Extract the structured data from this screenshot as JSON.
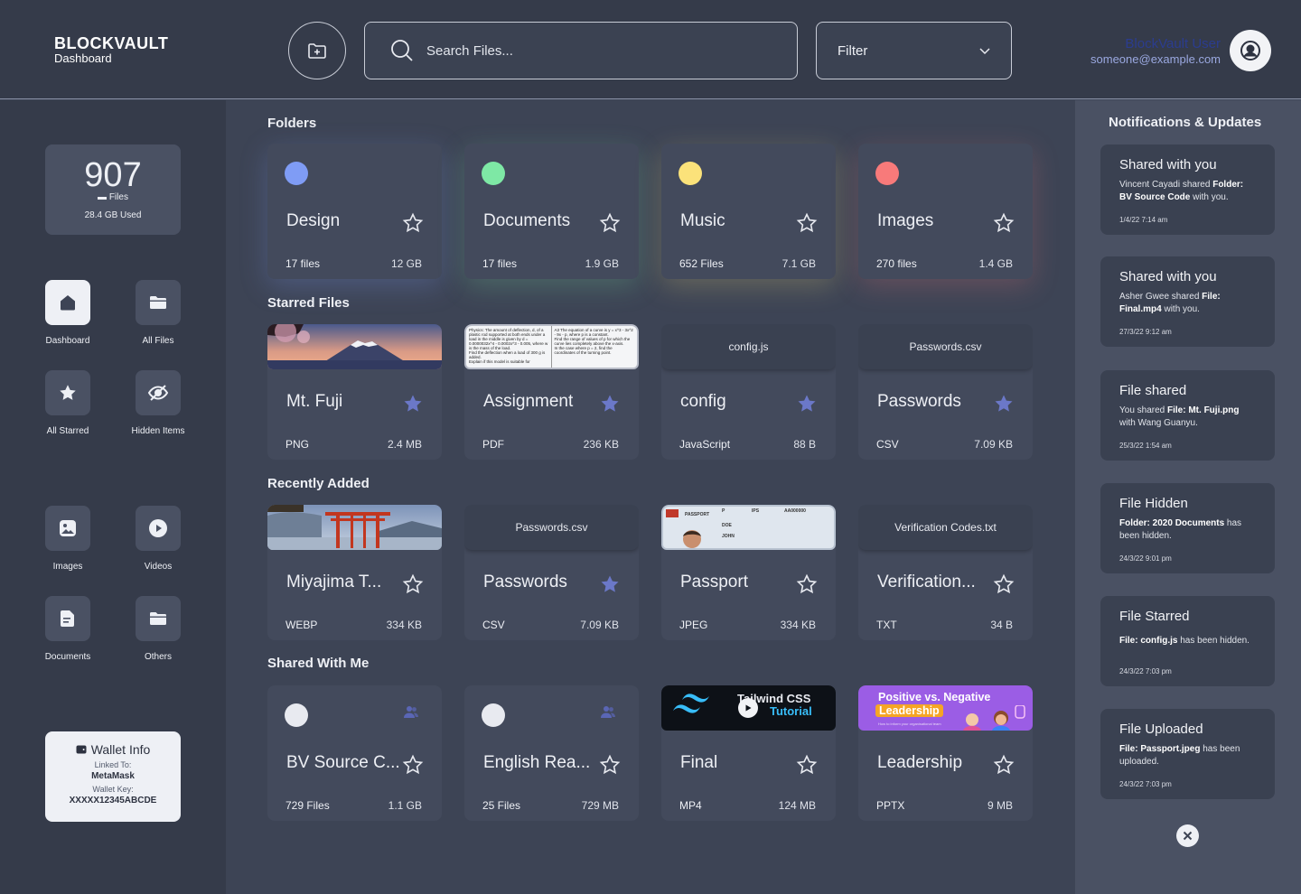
{
  "header": {
    "logo_title": "BLOCKVAULT",
    "logo_subtitle": "Dashboard",
    "search_placeholder": "Search Files...",
    "filter_label": "Filter",
    "user_name": "BlockVault User",
    "user_email": "someone@example.com"
  },
  "stats": {
    "count": "907",
    "count_label": "Files",
    "used": "28.4 GB Used"
  },
  "nav": [
    {
      "label": "Dashboard",
      "icon": "home-icon"
    },
    {
      "label": "All Files",
      "icon": "folder-icon"
    },
    {
      "label": "All Starred",
      "icon": "star-icon"
    },
    {
      "label": "Hidden Items",
      "icon": "eye-off-icon"
    },
    {
      "label": "Images",
      "icon": "image-icon"
    },
    {
      "label": "Videos",
      "icon": "play-icon"
    },
    {
      "label": "Documents",
      "icon": "document-icon"
    },
    {
      "label": "Others",
      "icon": "folder-icon"
    }
  ],
  "wallet": {
    "title": "Wallet Info",
    "linked_label": "Linked To:",
    "linked_value": "MetaMask",
    "key_label": "Wallet Key:",
    "key_value": "XXXXX12345ABCDE"
  },
  "sections": {
    "folders": "Folders",
    "starred": "Starred Files",
    "recent": "Recently Added",
    "shared": "Shared With Me"
  },
  "folders": [
    {
      "name": "Design",
      "count": "17 files",
      "size": "12 GB",
      "color": "#7f9cf5"
    },
    {
      "name": "Documents",
      "count": "17 files",
      "size": "1.9 GB",
      "color": "#7ee8a5"
    },
    {
      "name": "Music",
      "count": "652 Files",
      "size": "7.1 GB",
      "color": "#fbe27a"
    },
    {
      "name": "Images",
      "count": "270 files",
      "size": "1.4 GB",
      "color": "#f87a7a"
    }
  ],
  "starred": [
    {
      "name": "Mt. Fuji",
      "type": "PNG",
      "size": "2.4 MB"
    },
    {
      "name": "Assignment",
      "type": "PDF",
      "size": "236 KB"
    },
    {
      "name": "config",
      "type": "JavaScript",
      "size": "88 B",
      "file": "config.js"
    },
    {
      "name": "Passwords",
      "type": "CSV",
      "size": "7.09 KB",
      "file": "Passwords.csv"
    }
  ],
  "recent": [
    {
      "name": "Miyajima T...",
      "type": "WEBP",
      "size": "334 KB"
    },
    {
      "name": "Passwords",
      "type": "CSV",
      "size": "7.09 KB",
      "file": "Passwords.csv"
    },
    {
      "name": "Passport",
      "type": "JPEG",
      "size": "334 KB"
    },
    {
      "name": "Verification...",
      "type": "TXT",
      "size": "34 B",
      "file": "Verification Codes.txt"
    }
  ],
  "shared": [
    {
      "name": "BV Source C...",
      "count": "729 Files",
      "size": "1.1 GB"
    },
    {
      "name": "English Rea...",
      "count": "25 Files",
      "size": "729 MB"
    },
    {
      "name": "Final",
      "type": "MP4",
      "size": "124 MB"
    },
    {
      "name": "Leadership",
      "type": "PPTX",
      "size": "9 MB"
    }
  ],
  "thumbs": {
    "assignment_q1": "Physics: The amount of deflection, d, of a plastic rod supported at both ends under a load in the middle is given by d = 0.0000032x^4 - 0.0002x^3 - 0.005, where w is the mass of the load.",
    "assignment_q1b": "Find the deflection when a load of 300 g is added.",
    "assignment_q1c": "Explain if this model is suitable for",
    "assignment_q2": "A3 The equation of a curve is y = x^3 - 3x^2 - 9x - p, where p is a constant.",
    "assignment_q2b": "Find the range of values of p for which the curve lies completely above the x-axis.",
    "assignment_q2c": "In the case where p = 2, find the coordinates of the turning point.",
    "passport_label": "PASSPORT",
    "passport_p": "P",
    "passport_ips": "IPS",
    "passport_num": "AA000000",
    "passport_surname": "DOE",
    "passport_given": "JOHN",
    "video_text1": "Tailwind CSS",
    "video_text2": "Tutorial",
    "pptx_line1": "Positive vs. Negative",
    "pptx_line2": "Leadership",
    "pptx_line3": "How to inform your organisational team"
  },
  "notifications_title": "Notifications & Updates",
  "notifications": [
    {
      "title": "Shared with you",
      "p1": "Vincent Cayadi shared ",
      "b1": "Folder:",
      "p2": "",
      "b2": "BV Source Code",
      "p3": " with you.",
      "time": "1/4/22 7:14 am"
    },
    {
      "title": "Shared with you",
      "p1": "Asher Gwee shared ",
      "b1": "File:",
      "p2": "",
      "b2": "Final.mp4",
      "p3": " with you.",
      "time": "27/3/22 9:12 am"
    },
    {
      "title": "File shared",
      "p1": "You shared ",
      "b1": "File: Mt. Fuji.png",
      "p2": "",
      "b2": "",
      "p3": " with Wang Guanyu.",
      "time": "25/3/22 1:54 am"
    },
    {
      "title": "File Hidden",
      "p1": "",
      "b1": "Folder: 2020 Documents",
      "p2": "",
      "b2": "",
      "p3": " has been hidden.",
      "time": "24/3/22 9:01 pm"
    },
    {
      "title": "File Starred",
      "p1": "",
      "b1": "File: config.js",
      "p2": "",
      "b2": "",
      "p3": " has been hidden.",
      "time": "24/3/22 7:03 pm"
    },
    {
      "title": "File Uploaded",
      "p1": "",
      "b1": "File: Passport.jpeg",
      "p2": "",
      "b2": "",
      "p3": " has been uploaded.",
      "time": "24/3/22 7:03 pm"
    }
  ],
  "colors": {
    "star_filled": "#6b78c8",
    "accent": "#7f9cf5",
    "user_name": "#2b3c8f",
    "user_email": "#9aa8e0"
  }
}
